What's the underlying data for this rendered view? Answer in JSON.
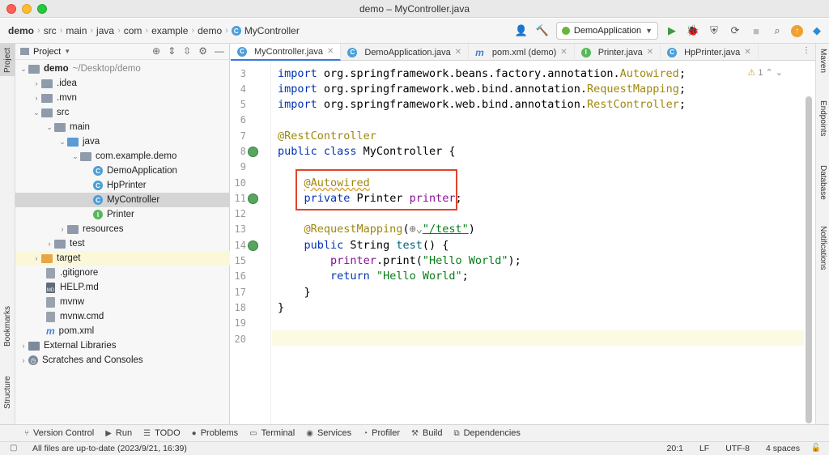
{
  "window": {
    "title": "demo – MyController.java"
  },
  "breadcrumb": [
    "demo",
    "src",
    "main",
    "java",
    "com",
    "example",
    "demo",
    "MyController"
  ],
  "run_config": {
    "label": "DemoApplication"
  },
  "left_strip": {
    "project": "Project",
    "bookmarks": "Bookmarks",
    "structure": "Structure"
  },
  "right_strip": {
    "maven": "Maven",
    "endpoints": "Endpoints",
    "database": "Database",
    "notifications": "Notifications"
  },
  "project_panel": {
    "title": "Project",
    "root_name": "demo",
    "root_path": "~/Desktop/demo",
    "items": [
      {
        "label": ".idea"
      },
      {
        "label": ".mvn"
      },
      {
        "label": "src"
      },
      {
        "label": "main"
      },
      {
        "label": "java"
      },
      {
        "label": "com.example.demo"
      },
      {
        "label": "DemoApplication"
      },
      {
        "label": "HpPrinter"
      },
      {
        "label": "MyController"
      },
      {
        "label": "Printer"
      },
      {
        "label": "resources"
      },
      {
        "label": "test"
      },
      {
        "label": "target"
      },
      {
        "label": ".gitignore"
      },
      {
        "label": "HELP.md"
      },
      {
        "label": "mvnw"
      },
      {
        "label": "mvnw.cmd"
      },
      {
        "label": "pom.xml"
      },
      {
        "label": "External Libraries"
      },
      {
        "label": "Scratches and Consoles"
      }
    ]
  },
  "tabs": [
    {
      "label": "MyController.java"
    },
    {
      "label": "DemoApplication.java"
    },
    {
      "label": "pom.xml (demo)"
    },
    {
      "label": "Printer.java"
    },
    {
      "label": "HpPrinter.java"
    }
  ],
  "editor": {
    "warning_count": "1",
    "line_numbers": [
      "3",
      "4",
      "5",
      "6",
      "7",
      "8",
      "9",
      "10",
      "11",
      "12",
      "13",
      "14",
      "15",
      "16",
      "17",
      "18",
      "19",
      "20"
    ]
  },
  "tool_windows": [
    "Version Control",
    "Run",
    "TODO",
    "Problems",
    "Terminal",
    "Services",
    "Profiler",
    "Build",
    "Dependencies"
  ],
  "status": {
    "message": "All files are up-to-date (2023/9/21, 16:39)",
    "position": "20:1",
    "line_sep": "LF",
    "encoding": "UTF-8",
    "indent": "4 spaces"
  }
}
